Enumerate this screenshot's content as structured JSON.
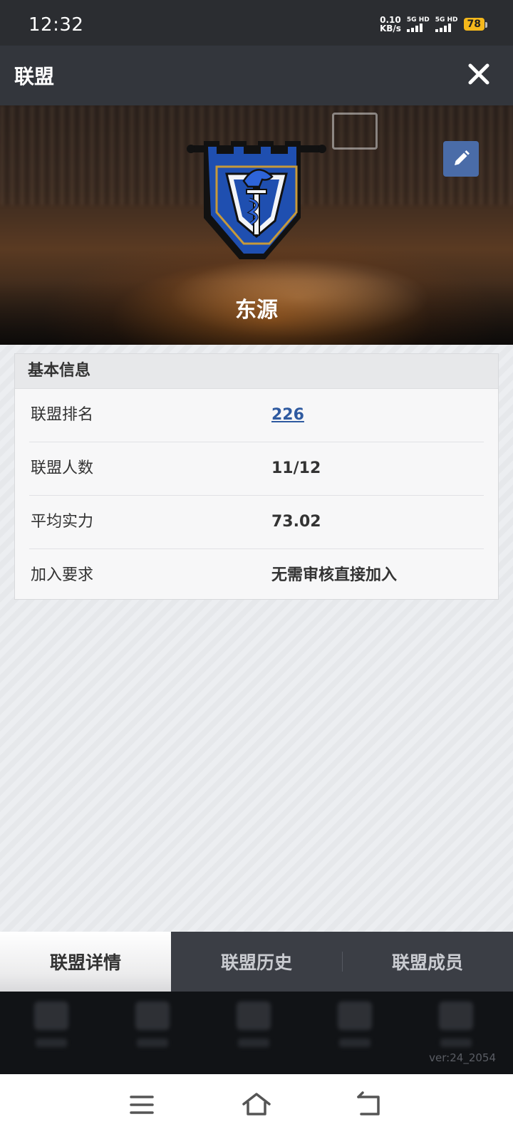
{
  "status_bar": {
    "time": "12:32",
    "net_speed_value": "0.10",
    "net_speed_unit": "KB/s",
    "sim1_label": "5G HD",
    "sim2_label": "5G HD",
    "battery": "78"
  },
  "header": {
    "title": "联盟",
    "close_icon": "close-icon"
  },
  "banner": {
    "team_name": "东源",
    "edit_icon": "pencil-icon",
    "emblem_icon": "knight-shield-emblem"
  },
  "info": {
    "heading": "基本信息",
    "rows": [
      {
        "label": "联盟排名",
        "value": "226"
      },
      {
        "label": "联盟人数",
        "value": "11/12"
      },
      {
        "label": "平均实力",
        "value": "73.02"
      },
      {
        "label": "加入要求",
        "value": "无需审核直接加入"
      }
    ]
  },
  "tabs": [
    {
      "label": "联盟详情",
      "active": true
    },
    {
      "label": "联盟历史",
      "active": false
    },
    {
      "label": "联盟成员",
      "active": false
    }
  ],
  "footer": {
    "version": "ver:24_2054"
  },
  "colors": {
    "accent_blue": "#2f5aa0",
    "header_bg": "#33363c",
    "battery": "#f5b81b"
  }
}
